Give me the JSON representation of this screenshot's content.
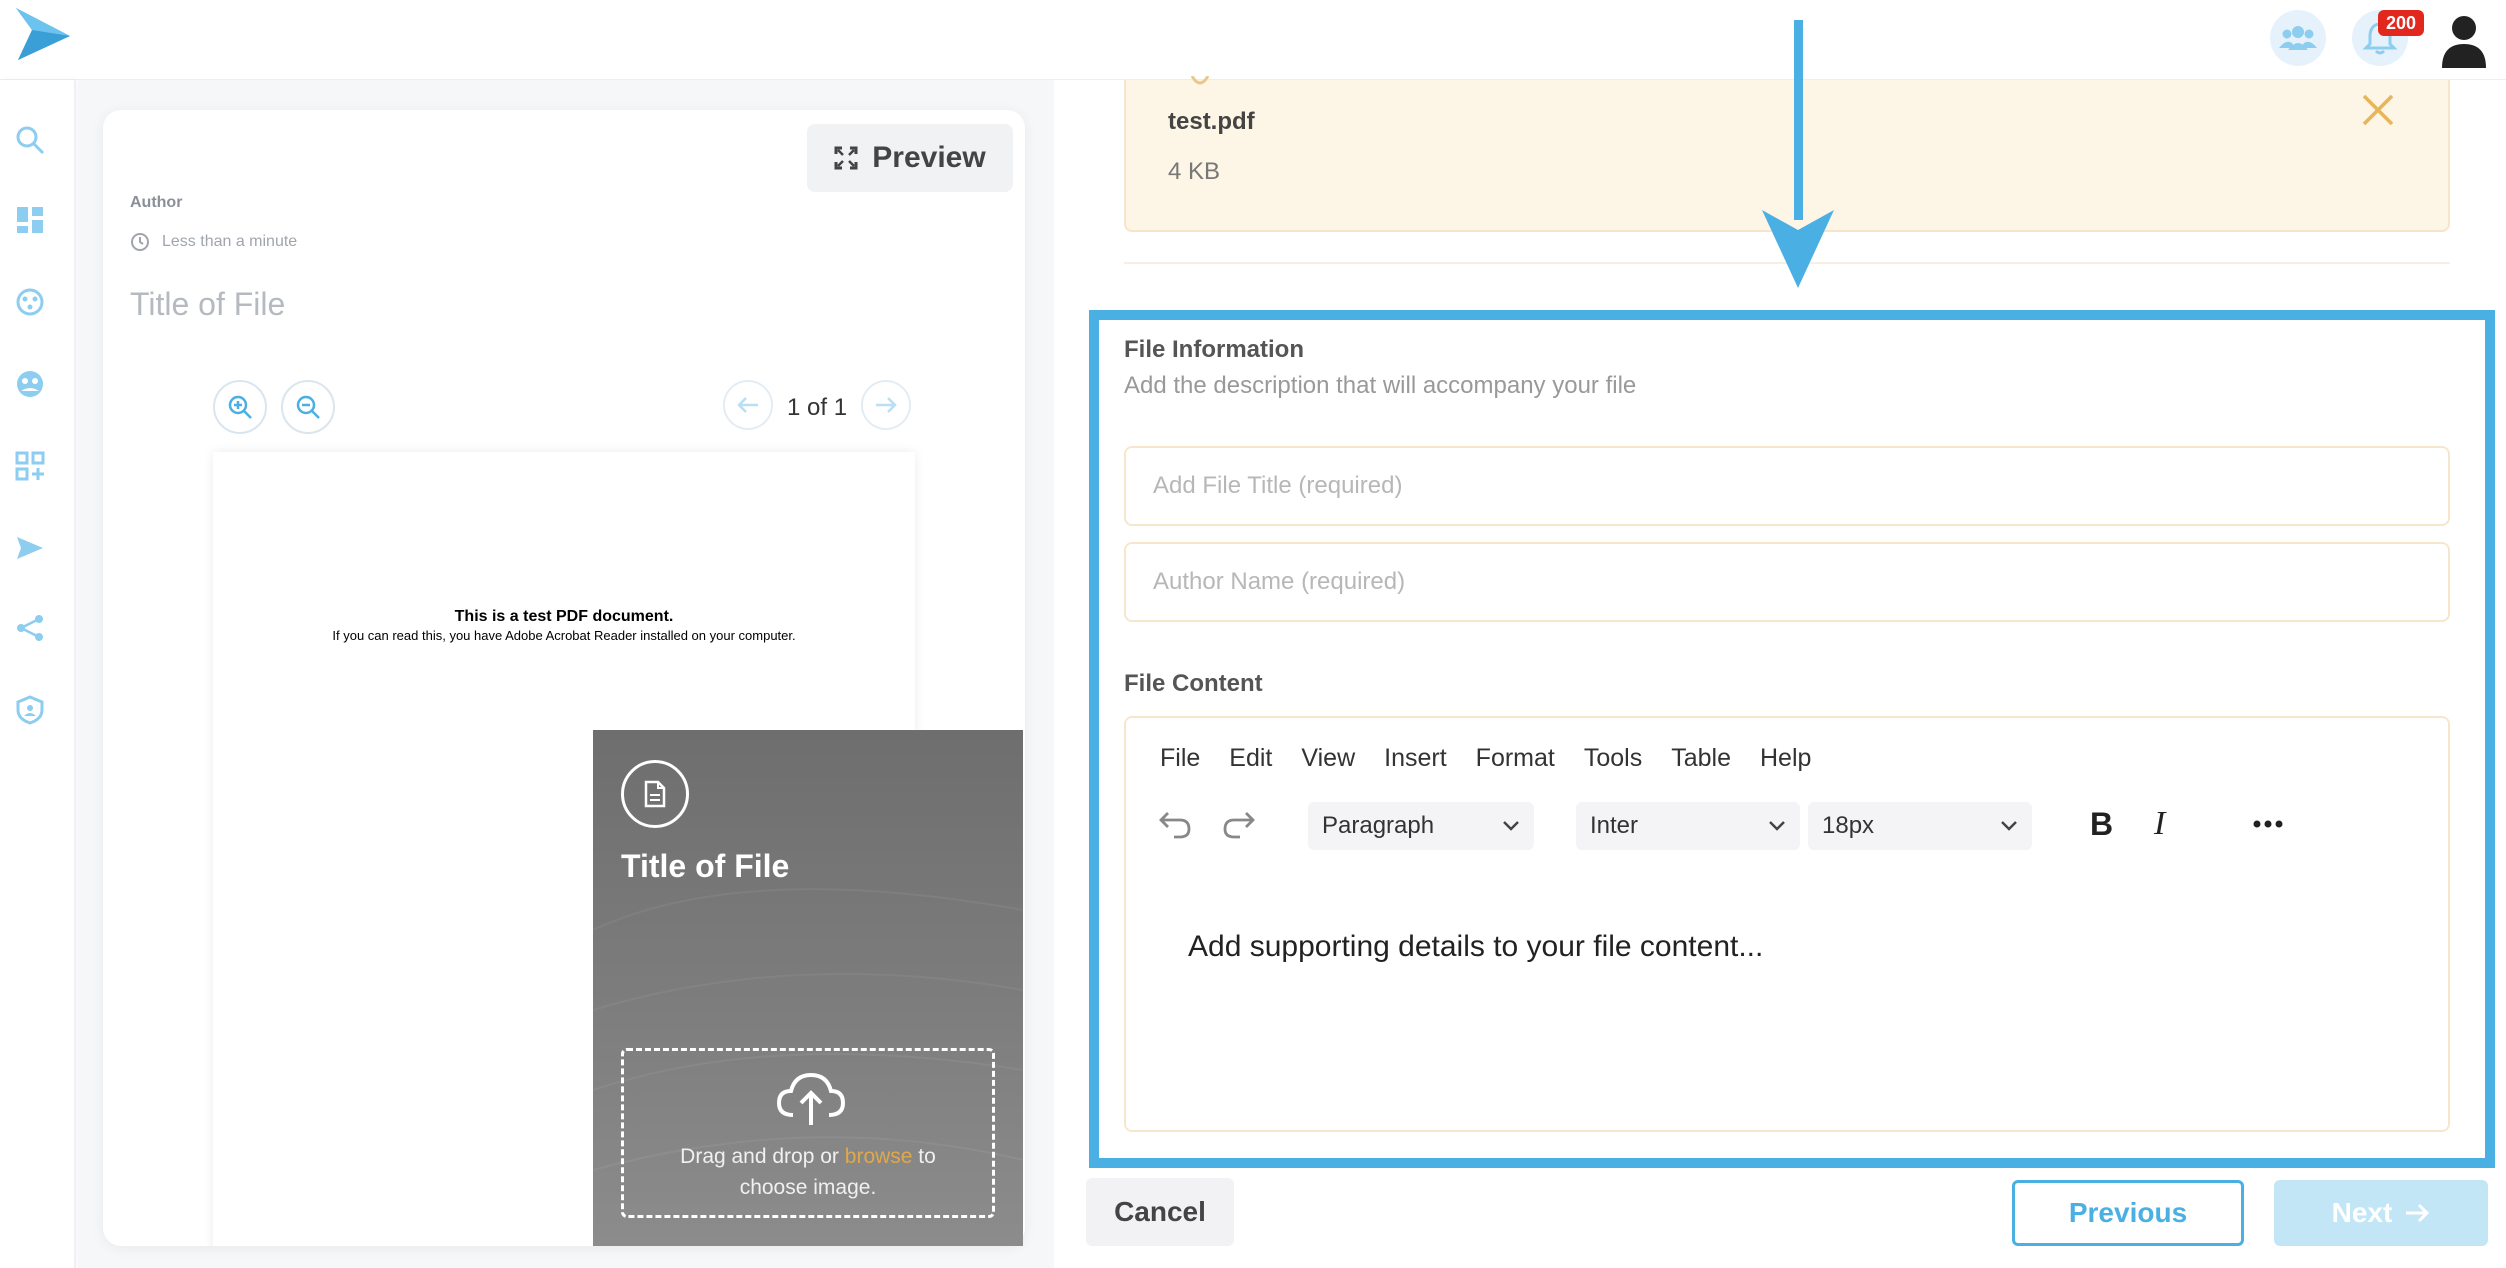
{
  "topbar": {
    "notifications_count": "200"
  },
  "icons": {
    "logo": "paper-plane-logo",
    "team": "users-icon",
    "notifications": "bell-icon",
    "profile": "user-avatar-icon"
  },
  "sidebar": {
    "items": [
      {
        "name": "search"
      },
      {
        "name": "dashboard"
      },
      {
        "name": "palette"
      },
      {
        "name": "community"
      },
      {
        "name": "add-apps"
      },
      {
        "name": "send"
      },
      {
        "name": "share"
      },
      {
        "name": "security"
      }
    ]
  },
  "preview": {
    "button_label": "Preview",
    "author_label": "Author",
    "time_label": "Less than a minute",
    "title": "Title of File",
    "page_indicator": "1 of 1",
    "pdf_heading": "This is a test PDF document.",
    "pdf_text": "If you can read this, you have Adobe Acrobat Reader installed on your computer."
  },
  "cover": {
    "title": "Title of File",
    "drop_text_before": "Drag and drop or ",
    "drop_browse": "browse",
    "drop_text_after": " to",
    "drop_text_line2": "choose image."
  },
  "file": {
    "name": "test.pdf",
    "size": "4 KB"
  },
  "form": {
    "info_title": "File Information",
    "info_subtitle": "Add the description that will accompany your file",
    "title_placeholder": "Add File Title (required)",
    "author_placeholder": "Author Name (required)",
    "content_title": "File Content"
  },
  "editor": {
    "menu": [
      "File",
      "Edit",
      "View",
      "Insert",
      "Format",
      "Tools",
      "Table",
      "Help"
    ],
    "block_format": "Paragraph",
    "font_family": "Inter",
    "font_size": "18px",
    "placeholder": "Add supporting details to your file content..."
  },
  "footer": {
    "cancel_label": "Cancel",
    "previous_label": "Previous",
    "next_label": "Next"
  },
  "colors": {
    "accent": "#4ab0e4",
    "file_box": "#fdf5e6",
    "badge": "#e2271f",
    "browse": "#e0a84a"
  }
}
